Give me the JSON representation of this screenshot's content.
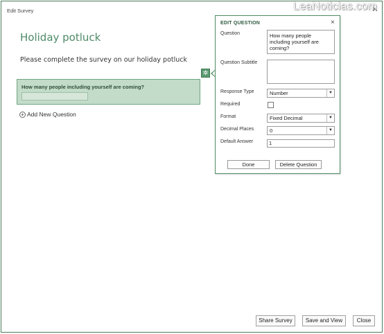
{
  "window": {
    "title": "Edit Survey",
    "close_glyph": "✕"
  },
  "watermark": "LeaNoticias.com",
  "survey": {
    "title": "Holiday potluck",
    "description": "Please complete the survey on our holiday potluck",
    "question": "How many people including yourself are coming?",
    "add_question_label": "Add New Question"
  },
  "edit_panel": {
    "title": "EDIT QUESTION",
    "close_glyph": "×",
    "question_label": "Question",
    "question_value": "How many people including yourself are coming?",
    "subtitle_label": "Question Subtitle",
    "subtitle_value": "",
    "response_type_label": "Response Type",
    "response_type_value": "Number",
    "required_label": "Required",
    "required_checked": false,
    "format_label": "Format",
    "format_value": "Fixed Decimal",
    "decimal_places_label": "Decimal Places",
    "decimal_places_value": "0",
    "default_answer_label": "Default Answer",
    "default_answer_value": "1",
    "done_label": "Done",
    "delete_label": "Delete Question"
  },
  "footer": {
    "share_label": "Share Survey",
    "save_view_label": "Save and View",
    "close_label": "Close"
  },
  "icons": {
    "gear": "gear-icon",
    "add": "add-circle-icon",
    "dropdown": "chevron-down-icon"
  },
  "colors": {
    "accent": "#4e8a68",
    "question_fill": "#c3dbc9",
    "border": "#4f8a63"
  }
}
